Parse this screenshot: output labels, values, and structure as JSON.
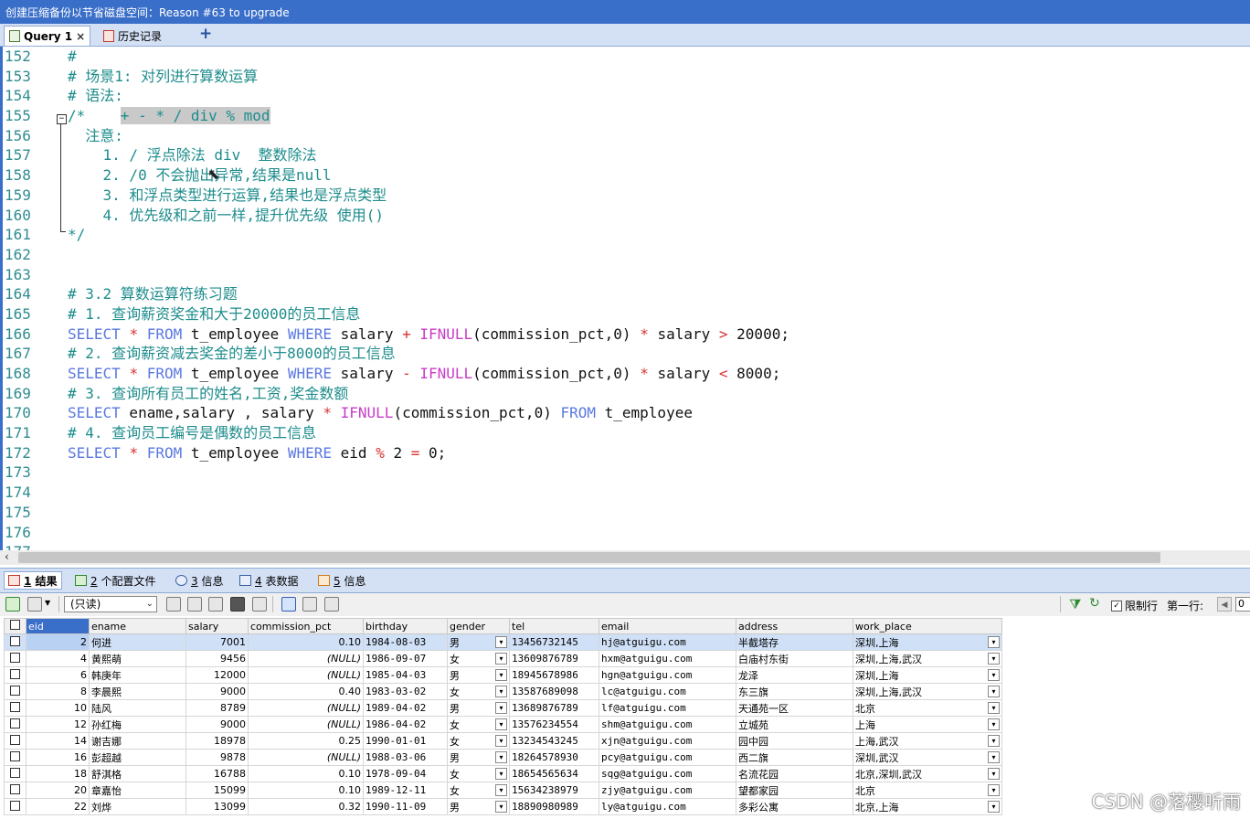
{
  "window": {
    "status_message": "创建压缩备份以节省磁盘空间：Reason #63 to upgrade"
  },
  "tabs": [
    {
      "label": "Query 1",
      "close": "×"
    },
    {
      "label": "历史记录"
    }
  ],
  "new_tab_label": "+",
  "editor": {
    "lines": [
      {
        "num": "152",
        "segs": [
          {
            "t": "#",
            "c": "cm"
          }
        ]
      },
      {
        "num": "153",
        "segs": [
          {
            "t": "# 场景1: 对列进行算数运算",
            "c": "cm"
          }
        ]
      },
      {
        "num": "154",
        "segs": [
          {
            "t": "# 语法:",
            "c": "cm"
          }
        ]
      },
      {
        "num": "155",
        "segs": [
          {
            "t": "/*    ",
            "c": "cm"
          },
          {
            "t": "+ - * / div % mod",
            "c": "cm sel"
          }
        ]
      },
      {
        "num": "156",
        "segs": [
          {
            "t": "  注意:",
            "c": "cm"
          }
        ]
      },
      {
        "num": "157",
        "segs": [
          {
            "t": "    1. / 浮点除法 div  整数除法",
            "c": "cm"
          }
        ]
      },
      {
        "num": "158",
        "segs": [
          {
            "t": "    2. /0 不会抛出异常,结果是null",
            "c": "cm"
          }
        ]
      },
      {
        "num": "159",
        "segs": [
          {
            "t": "    3. 和浮点类型进行运算,结果也是浮点类型",
            "c": "cm"
          }
        ]
      },
      {
        "num": "160",
        "segs": [
          {
            "t": "    4. 优先级和之前一样,提升优先级 使用()",
            "c": "cm"
          }
        ]
      },
      {
        "num": "161",
        "segs": [
          {
            "t": "*/",
            "c": "cm"
          }
        ]
      },
      {
        "num": "162",
        "segs": []
      },
      {
        "num": "163",
        "segs": []
      },
      {
        "num": "164",
        "segs": [
          {
            "t": "# 3.2 算数运算符练习题",
            "c": "cm"
          }
        ]
      },
      {
        "num": "165",
        "segs": [
          {
            "t": "# 1. 查询薪资奖金和大于20000的员工信息",
            "c": "cm"
          }
        ]
      },
      {
        "num": "166",
        "segs": [
          {
            "t": "SELECT",
            "c": "kw"
          },
          {
            "t": " ",
            "c": "pl"
          },
          {
            "t": "*",
            "c": "op"
          },
          {
            "t": " ",
            "c": "pl"
          },
          {
            "t": "FROM",
            "c": "kw"
          },
          {
            "t": " t_employee ",
            "c": "pl"
          },
          {
            "t": "WHERE",
            "c": "kw"
          },
          {
            "t": " salary ",
            "c": "pl"
          },
          {
            "t": "+",
            "c": "op"
          },
          {
            "t": " ",
            "c": "pl"
          },
          {
            "t": "IFNULL",
            "c": "fn"
          },
          {
            "t": "(commission_pct,0) ",
            "c": "pl"
          },
          {
            "t": "*",
            "c": "op"
          },
          {
            "t": " salary ",
            "c": "pl"
          },
          {
            "t": ">",
            "c": "op"
          },
          {
            "t": " 20000;",
            "c": "pl"
          }
        ]
      },
      {
        "num": "167",
        "segs": [
          {
            "t": "# 2. 查询薪资减去奖金的差小于8000的员工信息",
            "c": "cm"
          }
        ]
      },
      {
        "num": "168",
        "segs": [
          {
            "t": "SELECT",
            "c": "kw"
          },
          {
            "t": " ",
            "c": "pl"
          },
          {
            "t": "*",
            "c": "op"
          },
          {
            "t": " ",
            "c": "pl"
          },
          {
            "t": "FROM",
            "c": "kw"
          },
          {
            "t": " t_employee ",
            "c": "pl"
          },
          {
            "t": "WHERE",
            "c": "kw"
          },
          {
            "t": " salary ",
            "c": "pl"
          },
          {
            "t": "-",
            "c": "op"
          },
          {
            "t": " ",
            "c": "pl"
          },
          {
            "t": "IFNULL",
            "c": "fn"
          },
          {
            "t": "(commission_pct,0) ",
            "c": "pl"
          },
          {
            "t": "*",
            "c": "op"
          },
          {
            "t": " salary ",
            "c": "pl"
          },
          {
            "t": "<",
            "c": "op"
          },
          {
            "t": " 8000;",
            "c": "pl"
          }
        ]
      },
      {
        "num": "169",
        "segs": [
          {
            "t": "# 3. 查询所有员工的姓名,工资,奖金数额",
            "c": "cm"
          }
        ]
      },
      {
        "num": "170",
        "segs": [
          {
            "t": "SELECT",
            "c": "kw"
          },
          {
            "t": " ename,salary , salary ",
            "c": "pl"
          },
          {
            "t": "*",
            "c": "op"
          },
          {
            "t": " ",
            "c": "pl"
          },
          {
            "t": "IFNULL",
            "c": "fn"
          },
          {
            "t": "(commission_pct,0) ",
            "c": "pl"
          },
          {
            "t": "FROM",
            "c": "kw"
          },
          {
            "t": " t_employee",
            "c": "pl"
          }
        ]
      },
      {
        "num": "171",
        "segs": [
          {
            "t": "# 4. 查询员工编号是偶数的员工信息",
            "c": "cm"
          }
        ]
      },
      {
        "num": "172",
        "segs": [
          {
            "t": "SELECT",
            "c": "kw"
          },
          {
            "t": " ",
            "c": "pl"
          },
          {
            "t": "*",
            "c": "op"
          },
          {
            "t": " ",
            "c": "pl"
          },
          {
            "t": "FROM",
            "c": "kw"
          },
          {
            "t": " t_employee ",
            "c": "pl"
          },
          {
            "t": "WHERE",
            "c": "kw"
          },
          {
            "t": " eid ",
            "c": "pl"
          },
          {
            "t": "%",
            "c": "op"
          },
          {
            "t": " 2 ",
            "c": "pl"
          },
          {
            "t": "=",
            "c": "op"
          },
          {
            "t": " 0;",
            "c": "pl"
          }
        ]
      },
      {
        "num": "173",
        "segs": []
      },
      {
        "num": "174",
        "segs": []
      },
      {
        "num": "175",
        "segs": []
      },
      {
        "num": "176",
        "segs": []
      },
      {
        "num": "177",
        "segs": []
      }
    ]
  },
  "result_tabs": [
    {
      "num": "1",
      "label": " 结果"
    },
    {
      "num": "2",
      "label": " 个配置文件"
    },
    {
      "num": "3",
      "label": " 信息"
    },
    {
      "num": "4",
      "label": " 表数据"
    },
    {
      "num": "5",
      "label": " 信息"
    }
  ],
  "toolbar": {
    "mode_select": "(只读)",
    "limit_label": "限制行",
    "limit_checked": "✓",
    "first_row_label": "第一行:",
    "first_row_value": "0"
  },
  "table": {
    "columns": [
      "eid",
      "ename",
      "salary",
      "commission_pct",
      "birthday",
      "gender",
      "tel",
      "email",
      "address",
      "work_place"
    ],
    "rows": [
      [
        "2",
        "何进",
        "7001",
        "0.10",
        "1984-08-03",
        "男",
        "13456732145",
        "hj@atguigu.com",
        "半截塔存",
        "深圳,上海"
      ],
      [
        "4",
        "黄熙萌",
        "9456",
        "(NULL)",
        "1986-09-07",
        "女",
        "13609876789",
        "hxm@atguigu.com",
        "白庙村东街",
        "深圳,上海,武汉"
      ],
      [
        "6",
        "韩庚年",
        "12000",
        "(NULL)",
        "1985-04-03",
        "男",
        "18945678986",
        "hgn@atguigu.com",
        "龙泽",
        "深圳,上海"
      ],
      [
        "8",
        "李晨熙",
        "9000",
        "0.40",
        "1983-03-02",
        "女",
        "13587689098",
        "lc@atguigu.com",
        "东三旗",
        "深圳,上海,武汉"
      ],
      [
        "10",
        "陆风",
        "8789",
        "(NULL)",
        "1989-04-02",
        "男",
        "13689876789",
        "lf@atguigu.com",
        "天通苑一区",
        "北京"
      ],
      [
        "12",
        "孙红梅",
        "9000",
        "(NULL)",
        "1986-04-02",
        "女",
        "13576234554",
        "shm@atguigu.com",
        "立城苑",
        "上海"
      ],
      [
        "14",
        "谢吉娜",
        "18978",
        "0.25",
        "1990-01-01",
        "女",
        "13234543245",
        "xjn@atguigu.com",
        "园中园",
        "上海,武汉"
      ],
      [
        "16",
        "彭超越",
        "9878",
        "(NULL)",
        "1988-03-06",
        "男",
        "18264578930",
        "pcy@atguigu.com",
        "西二旗",
        "深圳,武汉"
      ],
      [
        "18",
        "舒淇格",
        "16788",
        "0.10",
        "1978-09-04",
        "女",
        "18654565634",
        "sqg@atguigu.com",
        "名流花园",
        "北京,深圳,武汉"
      ],
      [
        "20",
        "章嘉怡",
        "15099",
        "0.10",
        "1989-12-11",
        "女",
        "15634238979",
        "zjy@atguigu.com",
        "望都家园",
        "北京"
      ],
      [
        "22",
        "刘烨",
        "13099",
        "0.32",
        "1990-11-09",
        "男",
        "18890980989",
        "ly@atguigu.com",
        "多彩公寓",
        "北京,上海"
      ]
    ]
  },
  "watermark": "CSDN @落樱听雨",
  "colors": {
    "title_bar": "#3a6fc9",
    "keyword": "#5a78e0",
    "function": "#c83cc8",
    "comment": "#1e8c8c",
    "operator": "#d83232"
  }
}
